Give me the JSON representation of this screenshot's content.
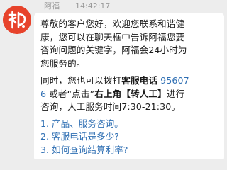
{
  "header": {
    "sender_name": "阿福",
    "timestamp": "14:42:17"
  },
  "avatar": {
    "icon": "afu-logo-icon",
    "color": "#e7432b"
  },
  "message": {
    "greeting_lines": [
      "尊敬的客户您好，欢迎您联系和谐健",
      "康，您可以在聊天框中告诉阿福您要",
      "咨询问题的关键字，阿福会24小时为",
      "您服务的。"
    ],
    "contact": {
      "line1_prefix": "同时，您也可以拨打",
      "hotline_label": "客服电话",
      "phone_part1": " 95607",
      "phone_part2": "6",
      "line2_middle": " 或者“点击”",
      "top_right_label": "右上角【转人工】",
      "line2_suffix": "进行",
      "line3": "咨询，人工服务时间7:30-21:30。"
    },
    "faq": [
      "1. 产品、服务咨询。",
      "2. 客服电话是多少?",
      "3. 如何查询结算利率?"
    ]
  },
  "colors": {
    "background": "#ededed",
    "bubble": "#ffffff",
    "link": "#2f6fb3",
    "brand": "#e7432b"
  }
}
